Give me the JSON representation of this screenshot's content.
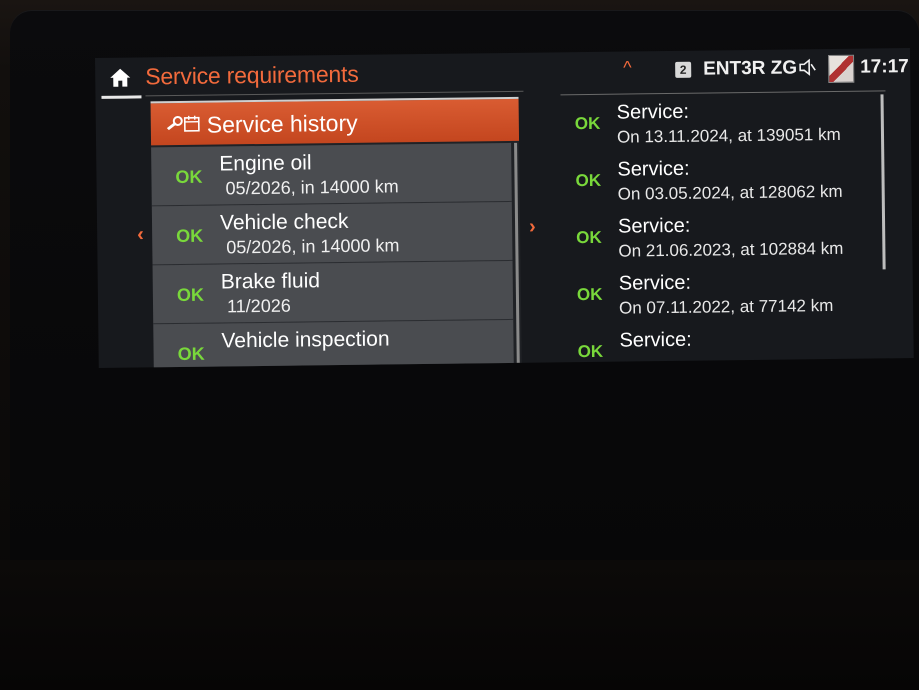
{
  "header": {
    "title": "Service requirements",
    "badge": "2",
    "plate": "ENT3R ZG",
    "time": "17:17",
    "up_arrow": "^"
  },
  "nav": {
    "left_arrow": "‹",
    "right_arrow": "›"
  },
  "service_list": {
    "header_label": "Service history",
    "items": [
      {
        "status": "OK",
        "name": "Engine oil",
        "detail": "05/2026, in 14000 km"
      },
      {
        "status": "OK",
        "name": "Vehicle check",
        "detail": "05/2026, in 14000 km"
      },
      {
        "status": "OK",
        "name": "Brake fluid",
        "detail": "11/2026"
      },
      {
        "status": "OK",
        "name": "Vehicle inspection",
        "detail": ""
      }
    ]
  },
  "history": [
    {
      "status": "OK",
      "label": "Service:",
      "detail": "On 13.11.2024, at 139051 km"
    },
    {
      "status": "OK",
      "label": "Service:",
      "detail": "On 03.05.2024, at 128062 km"
    },
    {
      "status": "OK",
      "label": "Service:",
      "detail": "On 21.06.2023, at 102884 km"
    },
    {
      "status": "OK",
      "label": "Service:",
      "detail": "On 07.11.2022, at 77142 km"
    },
    {
      "status": "OK",
      "label": "Service:",
      "detail": ""
    }
  ],
  "colors": {
    "accent": "#f26a3c",
    "ok": "#79d83b",
    "header_bg": "#c9491f"
  },
  "icons": {
    "home": "home-icon",
    "service": "service-history-icon",
    "mute": "speaker-mute-icon"
  }
}
